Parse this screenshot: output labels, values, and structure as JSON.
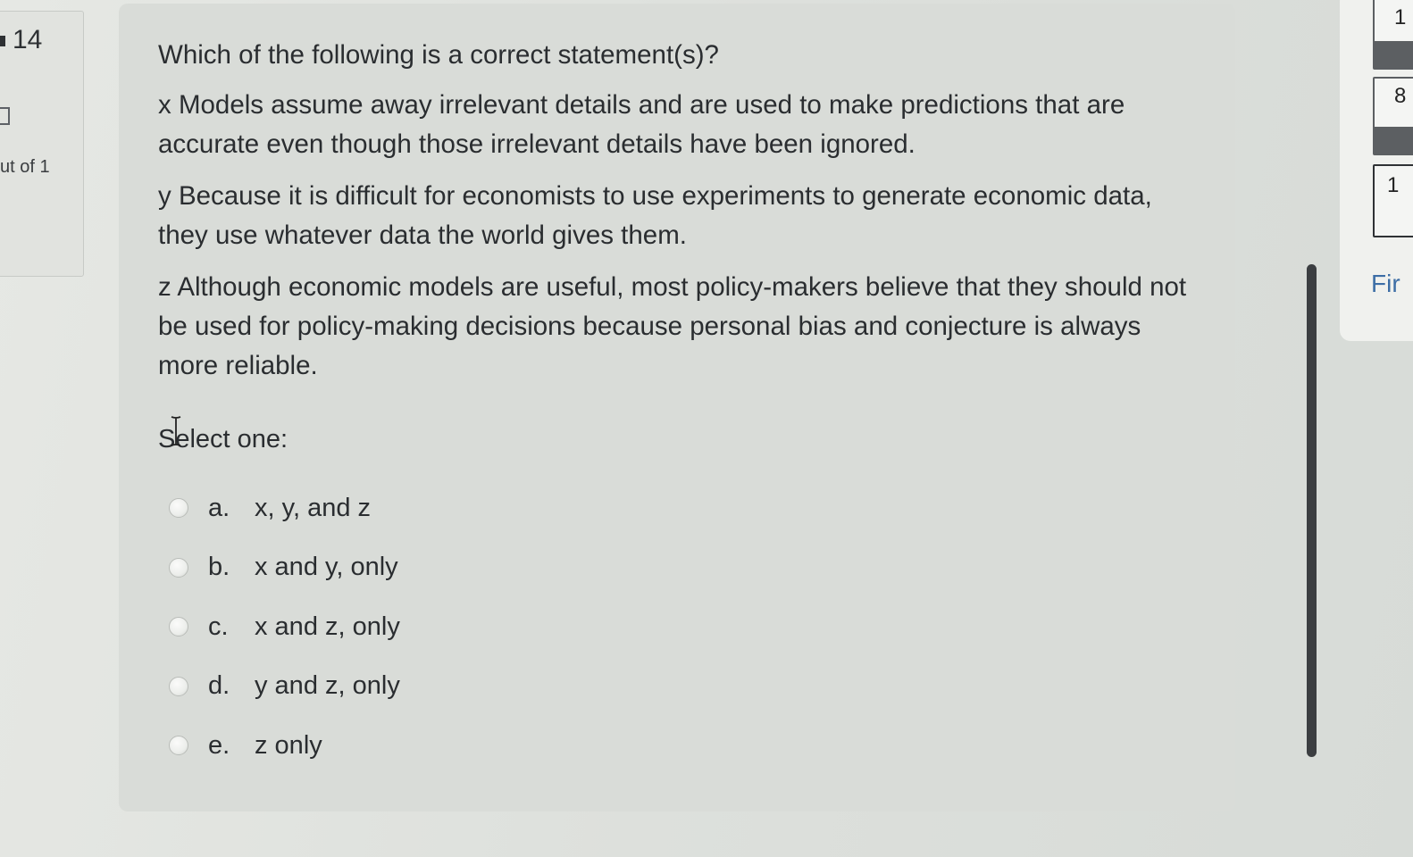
{
  "info": {
    "question_number": "14",
    "marks": "ut of 1"
  },
  "question": {
    "prompt": "Which of the following is a correct statement(s)?",
    "statements": [
      "x Models assume away irrelevant details and are used to make predictions that are accurate even though those irrelevant details have been ignored.",
      "y Because it is difficult for economists to use experiments to generate economic data, they use whatever data the world gives them.",
      "z Although economic models are useful, most policy-makers believe that they should not be used for policy-making decisions because personal bias and conjecture is always more reliable."
    ],
    "select_label": "Select one:",
    "options": [
      {
        "letter": "a.",
        "text": "x, y, and z"
      },
      {
        "letter": "b.",
        "text": "x and y, only"
      },
      {
        "letter": "c.",
        "text": "x and z, only"
      },
      {
        "letter": "d.",
        "text": "y and z, only"
      },
      {
        "letter": "e.",
        "text": "z only"
      }
    ]
  },
  "navigation": {
    "tiles": [
      "1",
      "8",
      "1"
    ],
    "finish_label": "Fir"
  },
  "icons": {
    "cursor": "text-cursor-icon",
    "radio": "radio-unchecked-icon"
  }
}
